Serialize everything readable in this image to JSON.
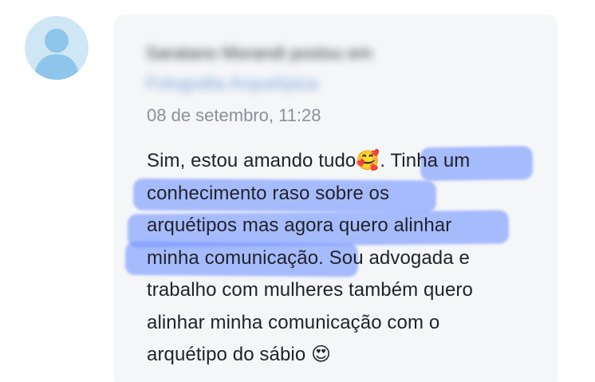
{
  "post": {
    "author_line": "Saratano Morandi postou em",
    "group_line": "Fotografia Arquetípica",
    "timestamp": "08 de setembro, 11:28",
    "message_lines": [
      "Sim, estou amando tudo🥰. Tinha um",
      "conhecimento raso sobre os",
      "arquétipos mas agora quero alinhar",
      "minha comunicação. Sou advogada e",
      "trabalho com mulheres também quero",
      "alinhar minha comunicação com o",
      "arquétipo do sábio 😍"
    ]
  },
  "colors": {
    "card_background": "#f5f6f8",
    "avatar_background": "#cfe6f4",
    "highlight": "#7696ff",
    "timestamp_text": "#8b9099",
    "body_text": "#1f2229"
  },
  "icons": {
    "avatar": "default-user-silhouette-icon"
  }
}
